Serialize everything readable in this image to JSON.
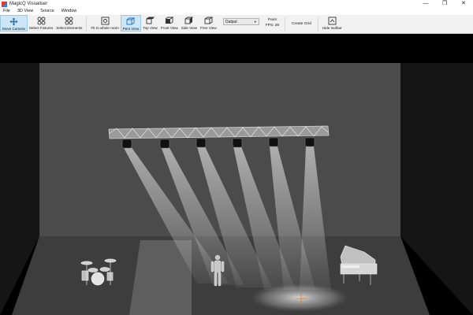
{
  "window": {
    "title": "MagicQ Visualiser",
    "controls": [
      "—",
      "❐",
      "✕"
    ]
  },
  "menu": [
    "File",
    "3D View",
    "Source",
    "Window"
  ],
  "toolbar": {
    "move_camera": "Move Camera",
    "select_fixtures": "Select Fixtures",
    "select_elements": "Select Elements",
    "fit_to_room": "Fit to whole room",
    "pers_view": "Pers View",
    "top_view": "Top View",
    "front_view": "Front View",
    "side_view": "Side View",
    "free_view": "Free View",
    "output_value": "Output",
    "paint": "Paint",
    "fps": "FPS: 29",
    "create_grid": "Create Grid",
    "hide_toolbar": "Hide toolbar"
  },
  "colors": {
    "toolbar_bg": "#f1f1f1",
    "active_bg": "#cde6f7",
    "stage_wall": "#4a4a4a",
    "stage_floor": "#3d3d3d"
  }
}
